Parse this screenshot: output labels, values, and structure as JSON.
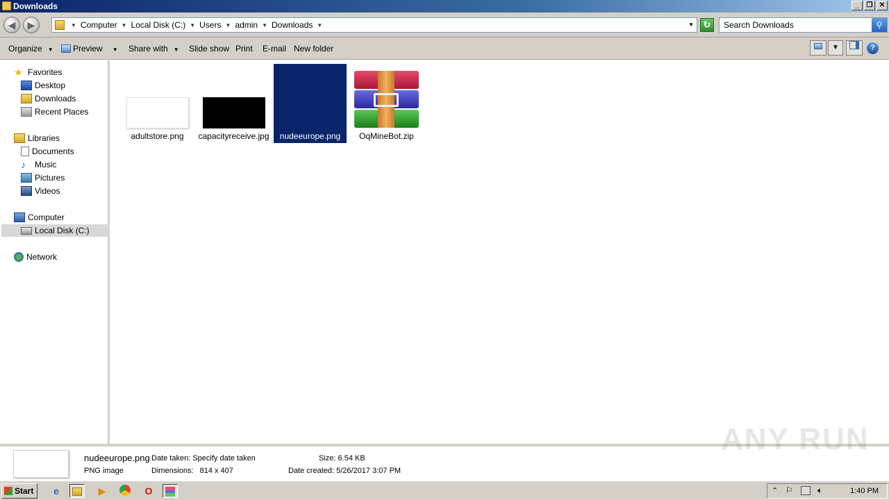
{
  "window": {
    "title": "Downloads"
  },
  "breadcrumb": [
    "Computer",
    "Local Disk (C:)",
    "Users",
    "admin",
    "Downloads"
  ],
  "search": {
    "placeholder": "Search Downloads"
  },
  "toolbar": {
    "organize": "Organize",
    "preview": "Preview",
    "share_with": "Share with",
    "slide_show": "Slide show",
    "print": "Print",
    "email": "E-mail",
    "new_folder": "New folder"
  },
  "sidebar": {
    "favorites": "Favorites",
    "desktop": "Desktop",
    "downloads": "Downloads",
    "recent_places": "Recent Places",
    "libraries": "Libraries",
    "documents": "Documents",
    "music": "Music",
    "pictures": "Pictures",
    "videos": "Videos",
    "computer": "Computer",
    "local_disk": "Local Disk (C:)",
    "network": "Network"
  },
  "files": [
    {
      "name": "adultstore.png"
    },
    {
      "name": "capacityreceive.jpg"
    },
    {
      "name": "nudeeurope.png"
    },
    {
      "name": "OqMineBot.zip"
    }
  ],
  "details": {
    "name": "nudeeurope.png",
    "type": "PNG image",
    "date_taken_label": "Date taken:",
    "date_taken_value": "Specify date taken",
    "dimensions_label": "Dimensions:",
    "dimensions_value": "814 x 407",
    "size_label": "Size:",
    "size_value": "6.54 KB",
    "date_created_label": "Date created:",
    "date_created_value": "5/26/2017 3:07 PM"
  },
  "watermark": "ANY RUN",
  "taskbar": {
    "start": "Start",
    "clock": "1:40 PM"
  }
}
